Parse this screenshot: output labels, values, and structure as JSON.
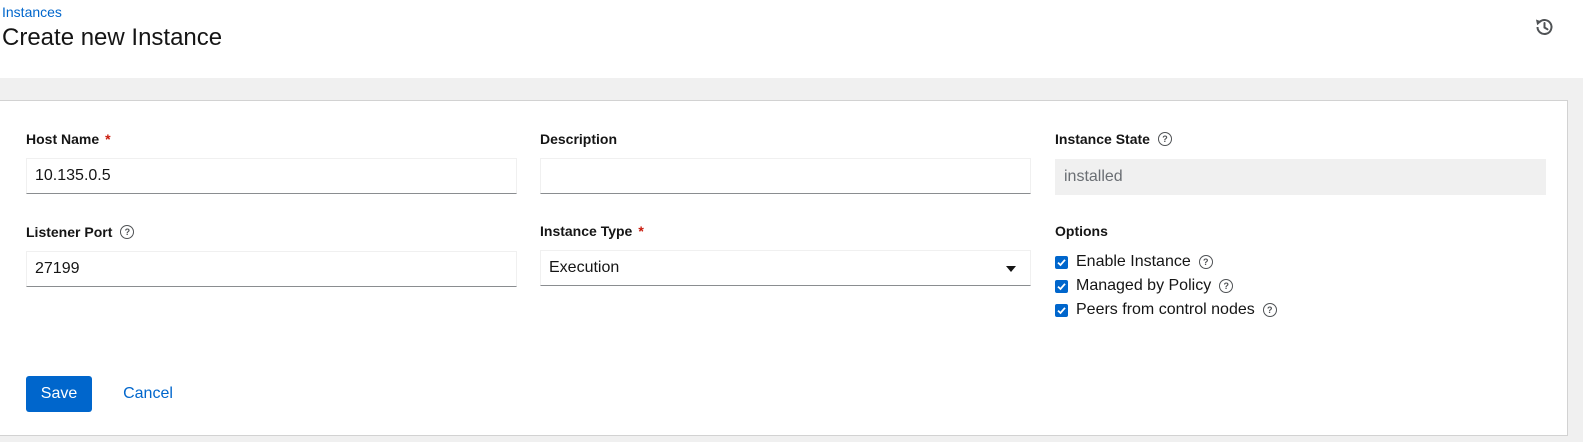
{
  "breadcrumb": {
    "parent": "Instances"
  },
  "page": {
    "title": "Create new Instance"
  },
  "header": {
    "history_icon": "history-icon"
  },
  "form": {
    "host_name": {
      "label": "Host Name",
      "required": "*",
      "value": "10.135.0.5"
    },
    "description": {
      "label": "Description",
      "value": ""
    },
    "instance_state": {
      "label": "Instance State",
      "value": "installed"
    },
    "listener_port": {
      "label": "Listener Port",
      "value": "27199"
    },
    "instance_type": {
      "label": "Instance Type",
      "required": "*",
      "value": "Execution"
    },
    "options": {
      "label": "Options",
      "items": [
        {
          "label": "Enable Instance",
          "checked": true
        },
        {
          "label": "Managed by Policy",
          "checked": true
        },
        {
          "label": "Peers from control nodes",
          "checked": true
        }
      ]
    }
  },
  "actions": {
    "save": "Save",
    "cancel": "Cancel"
  },
  "help_glyph": "?",
  "colors": {
    "accent": "#0066cc",
    "required": "#c9190b"
  }
}
